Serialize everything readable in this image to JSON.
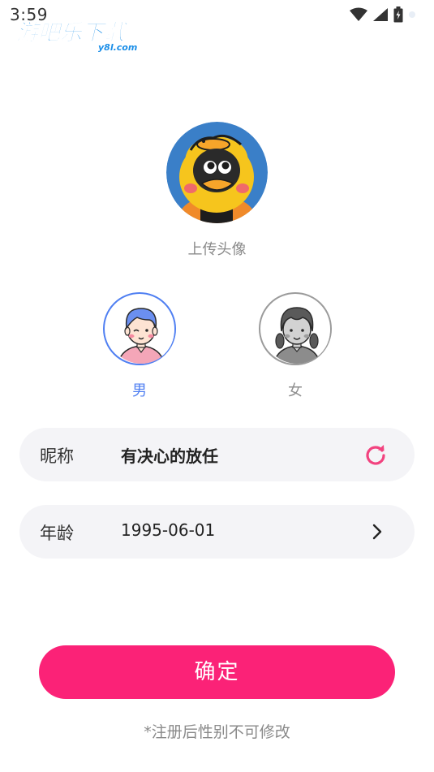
{
  "status_bar": {
    "time": "3:59",
    "icons": [
      "wifi-icon",
      "signal-icon",
      "battery-icon"
    ]
  },
  "watermark": {
    "text": "游吧乐下载",
    "domain": "y8l.com",
    "color": "#1a8ee8"
  },
  "avatar": {
    "upload_label": "上传头像",
    "image": "cartoon-duck-avatar"
  },
  "gender": {
    "selected": "male",
    "options": [
      {
        "id": "male",
        "label": "男",
        "color": "#4f7ff2"
      },
      {
        "id": "female",
        "label": "女",
        "color": "#8f8f8f"
      }
    ]
  },
  "form": {
    "nickname": {
      "label": "昵称",
      "value": "有决心的放任",
      "action_icon": "refresh-icon",
      "icon_color": "#f2437f"
    },
    "age": {
      "label": "年龄",
      "value": "1995-06-01",
      "action_icon": "chevron-right-icon"
    }
  },
  "confirm": {
    "label": "确定",
    "color": "#fb2277"
  },
  "notice": "*注册后性别不可修改"
}
